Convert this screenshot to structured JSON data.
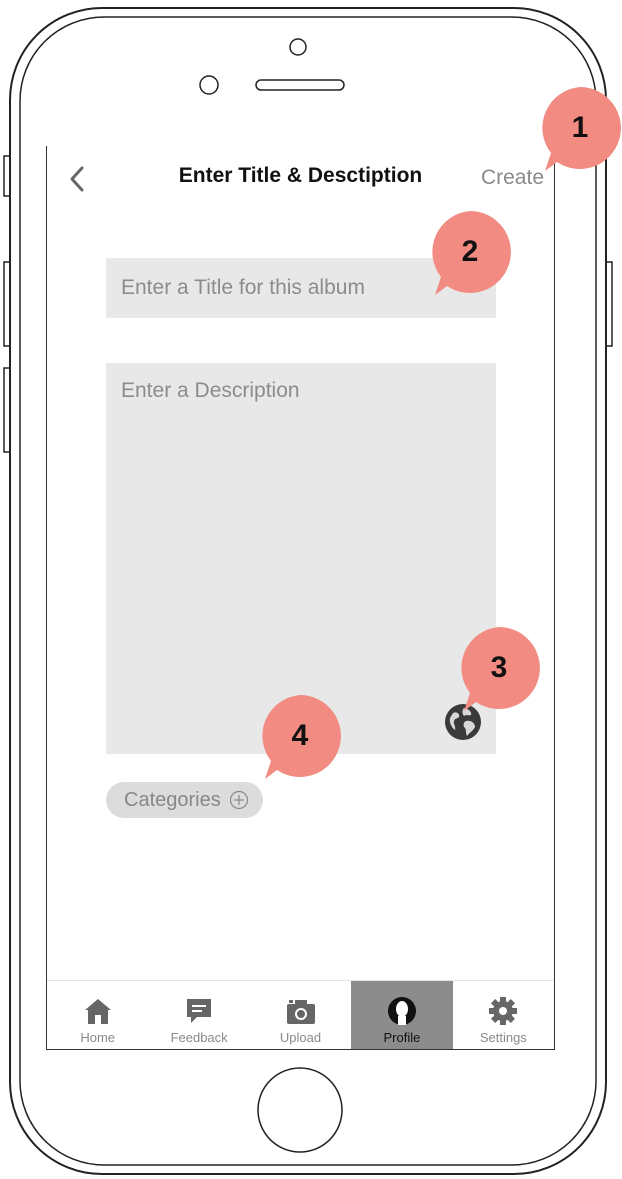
{
  "nav": {
    "title": "Enter Title & Desctiption",
    "create_label": "Create"
  },
  "form": {
    "title_placeholder": "Enter a Title for this album",
    "description_placeholder": "Enter a Description",
    "categories_label": "Categories"
  },
  "tabs": [
    {
      "label": "Home",
      "icon": "home-icon",
      "active": false
    },
    {
      "label": "Feedback",
      "icon": "chat-bubble-icon",
      "active": false
    },
    {
      "label": "Upload",
      "icon": "camera-icon",
      "active": false
    },
    {
      "label": "Profile",
      "icon": "user-icon",
      "active": true
    },
    {
      "label": "Settings",
      "icon": "gear-icon",
      "active": false
    }
  ],
  "callouts": [
    "1",
    "2",
    "3",
    "4"
  ],
  "colors": {
    "callout": "#f28b82",
    "input_bg": "#e8e8e8",
    "active_tab": "#8c8c8c"
  }
}
